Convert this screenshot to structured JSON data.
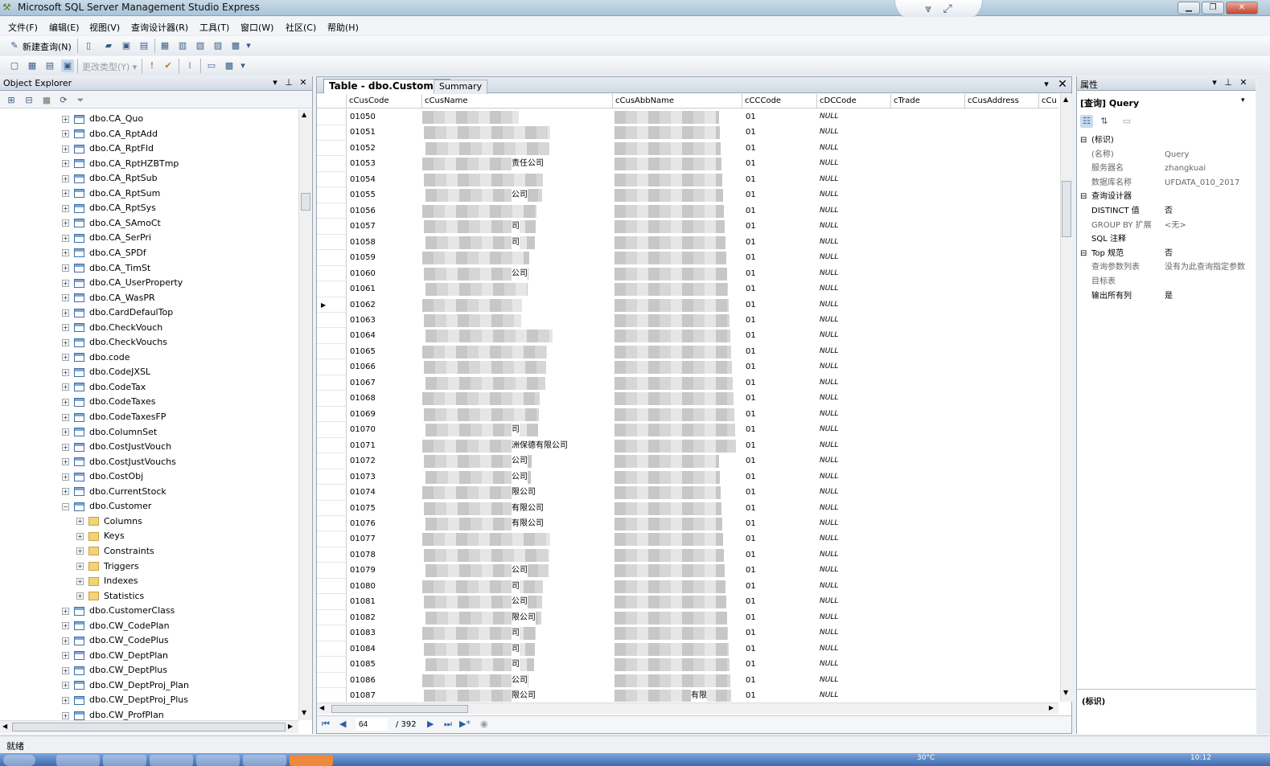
{
  "window": {
    "title": "Microsoft SQL Server Management Studio Express"
  },
  "menus": [
    "文件(F)",
    "编辑(E)",
    "视图(V)",
    "查询设计器(R)",
    "工具(T)",
    "窗口(W)",
    "社区(C)",
    "帮助(H)"
  ],
  "toolbar": {
    "new_query": "新建查询(N)",
    "change_type": "更改类型(Y) ▾"
  },
  "object_explorer": {
    "title": "Object Explorer",
    "tables_before": [
      "dbo.CA_Quo",
      "dbo.CA_RptAdd",
      "dbo.CA_RptFld",
      "dbo.CA_RptHZBTmp",
      "dbo.CA_RptSub",
      "dbo.CA_RptSum",
      "dbo.CA_RptSys",
      "dbo.CA_SAmoCt",
      "dbo.CA_SerPri",
      "dbo.CA_SPDf",
      "dbo.CA_TimSt",
      "dbo.CA_UserProperty",
      "dbo.CA_WasPR",
      "dbo.CardDefaulTop",
      "dbo.CheckVouch",
      "dbo.CheckVouchs",
      "dbo.code",
      "dbo.CodeJXSL",
      "dbo.CodeTax",
      "dbo.CodeTaxes",
      "dbo.CodeTaxesFP",
      "dbo.ColumnSet",
      "dbo.CostJustVouch",
      "dbo.CostJustVouchs",
      "dbo.CostObj",
      "dbo.CurrentStock"
    ],
    "expanded_table": "dbo.Customer",
    "folders": [
      "Columns",
      "Keys",
      "Constraints",
      "Triggers",
      "Indexes",
      "Statistics"
    ],
    "tables_after": [
      "dbo.CustomerClass",
      "dbo.CW_CodePlan",
      "dbo.CW_CodePlus",
      "dbo.CW_DeptPlan",
      "dbo.CW_DeptPlus",
      "dbo.CW_DeptProj_Plan",
      "dbo.CW_DeptProj_Plus",
      "dbo.CW_ProfPlan"
    ]
  },
  "document": {
    "tab_active": "Table - dbo.Customer",
    "tab_summary": "Summary",
    "columns": [
      "cCusCode",
      "cCusName",
      "cCusAbbName",
      "cCCCode",
      "cDCCode",
      "cTrade",
      "cCusAddress",
      "cCu"
    ],
    "rows": [
      "01050",
      "01051",
      "01052",
      "01053",
      "01054",
      "01055",
      "01056",
      "01057",
      "01058",
      "01059",
      "01060",
      "01061",
      "01062",
      "01063",
      "01064",
      "01065",
      "01066",
      "01067",
      "01068",
      "01069",
      "01070",
      "01071",
      "01072",
      "01073",
      "01074",
      "01075",
      "01076",
      "01077",
      "01078",
      "01079",
      "01080",
      "01081",
      "01082",
      "01083",
      "01084",
      "01085",
      "01086",
      "01087"
    ],
    "ccccode_value": "01",
    "null_value": "NULL",
    "current_row_code": "01062",
    "name_fragments": [
      {
        "row": 3,
        "text": "责任公司"
      },
      {
        "row": 5,
        "text": "公司"
      },
      {
        "row": 7,
        "text": "司"
      },
      {
        "row": 8,
        "text": "司"
      },
      {
        "row": 10,
        "text": "公司"
      },
      {
        "row": 20,
        "text": "司"
      },
      {
        "row": 21,
        "text": "洲保德有限公司"
      },
      {
        "row": 22,
        "text": "公司"
      },
      {
        "row": 23,
        "text": "公司"
      },
      {
        "row": 24,
        "text": "限公司"
      },
      {
        "row": 25,
        "text": "有限公司"
      },
      {
        "row": 26,
        "text": "有限公司"
      },
      {
        "row": 29,
        "text": "公司"
      },
      {
        "row": 30,
        "text": "司"
      },
      {
        "row": 31,
        "text": "公司"
      },
      {
        "row": 32,
        "text": "限公司"
      },
      {
        "row": 33,
        "text": "司"
      },
      {
        "row": 34,
        "text": "司"
      },
      {
        "row": 35,
        "text": "司"
      },
      {
        "row": 36,
        "text": "公司"
      },
      {
        "row": 37,
        "text": "限公司"
      }
    ],
    "abbname_fragment": {
      "row": 37,
      "text": "有限"
    },
    "nav": {
      "current": "64",
      "total": "/ 392"
    }
  },
  "properties": {
    "title": "属性",
    "object": "[查询] Query",
    "rows": [
      {
        "type": "cat",
        "name": "(标识)"
      },
      {
        "type": "prop",
        "name": "(名称)",
        "value": "Query",
        "dark": false
      },
      {
        "type": "prop",
        "name": "服务器名",
        "value": "zhangkuai",
        "dark": false
      },
      {
        "type": "prop",
        "name": "数据库名称",
        "value": "UFDATA_010_2017",
        "dark": false
      },
      {
        "type": "cat",
        "name": "查询设计器"
      },
      {
        "type": "prop",
        "name": "DISTINCT 值",
        "value": "否",
        "dark": true
      },
      {
        "type": "prop",
        "name": "GROUP BY 扩展",
        "value": "<无>",
        "dark": false
      },
      {
        "type": "prop",
        "name": "SQL 注释",
        "value": "",
        "dark": true
      },
      {
        "type": "cat",
        "name": "Top 规范",
        "value": "否"
      },
      {
        "type": "prop",
        "name": "查询参数列表",
        "value": "没有为此查询指定参数",
        "dark": false
      },
      {
        "type": "prop",
        "name": "目标表",
        "value": "",
        "dark": false
      },
      {
        "type": "prop",
        "name": "输出所有列",
        "value": "是",
        "dark": true
      }
    ],
    "description": "(标识)"
  },
  "status": {
    "text": "就绪"
  },
  "taskbar": {
    "temp": "30°C",
    "time": "10:12"
  }
}
